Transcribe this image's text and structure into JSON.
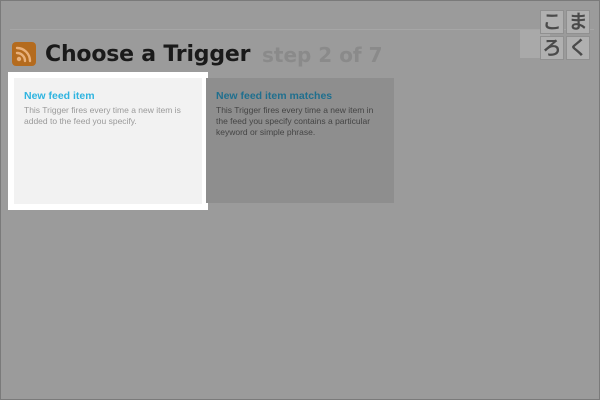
{
  "header": {
    "title": "Choose a Trigger",
    "step": "step 2 of 7"
  },
  "logo": {
    "chars": [
      "こ",
      "ま",
      "ろ",
      "く"
    ]
  },
  "triggers": [
    {
      "title": "New feed item",
      "description": "This Trigger fires every time a new item is added to the feed you specify."
    },
    {
      "title": "New feed item matches",
      "description": "This Trigger fires every time a new item in the feed you specify contains a particular keyword or simple phrase."
    }
  ],
  "colors": {
    "accent": "#2fb4e0",
    "rss": "#b46b1e"
  }
}
